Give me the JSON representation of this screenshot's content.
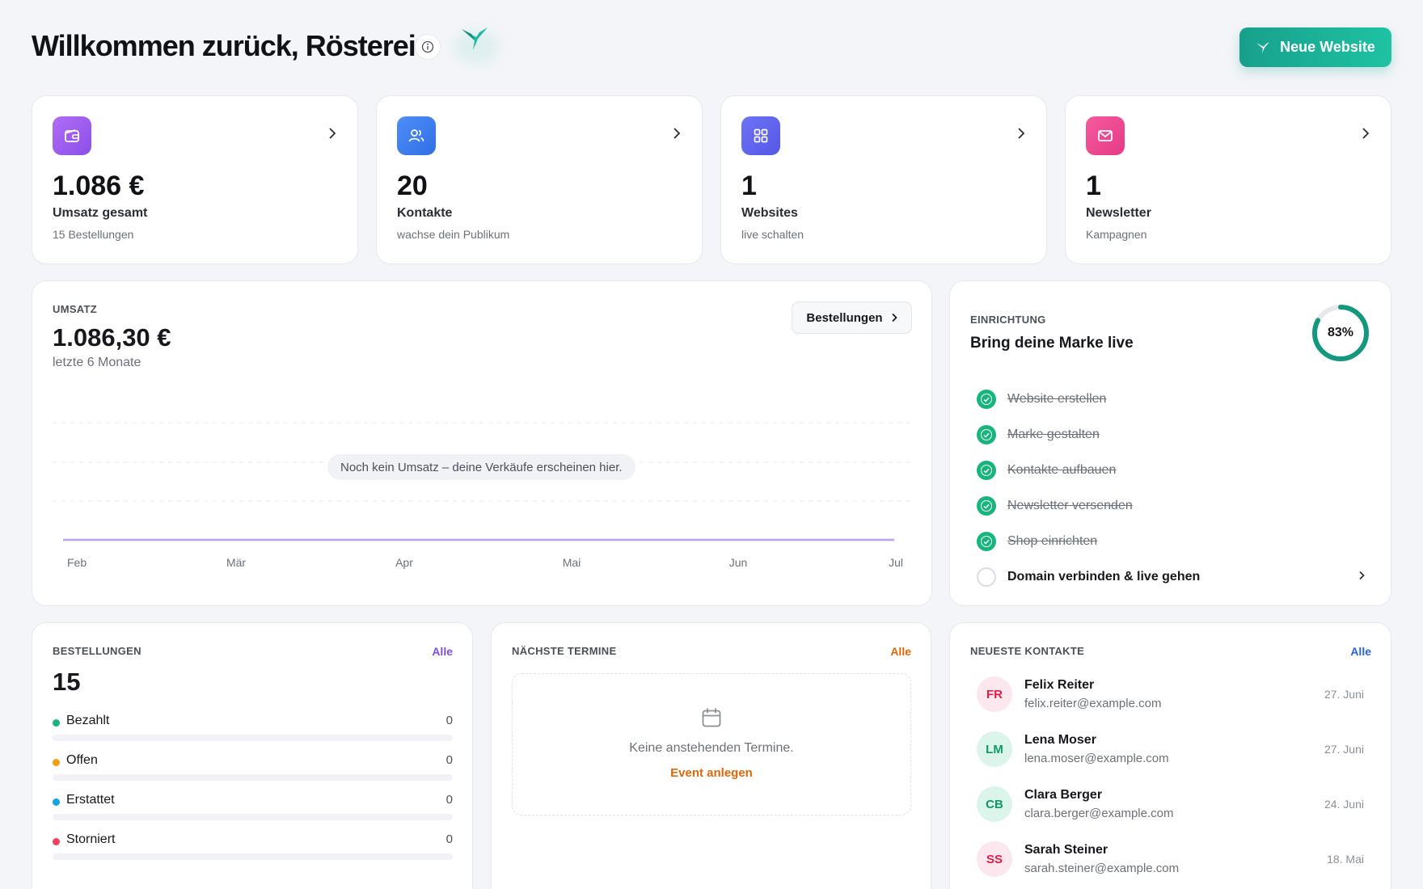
{
  "header": {
    "title": "Willkommen zurück, Rösterei",
    "new_website_label": "Neue Website"
  },
  "stats": [
    {
      "value": "1.086 €",
      "label": "Umsatz gesamt",
      "sub": "15 Bestellungen",
      "icon": "wallet-icon",
      "color": "#a05bf0"
    },
    {
      "value": "20",
      "label": "Kontakte",
      "sub": "wachse dein Publikum",
      "icon": "users-icon",
      "color": "#3b7ff2"
    },
    {
      "value": "1",
      "label": "Websites",
      "sub": "live schalten",
      "icon": "grid-icon",
      "color": "#6366f1"
    },
    {
      "value": "1",
      "label": "Newsletter",
      "sub": "Kampagnen",
      "icon": "mail-icon",
      "color": "#ec4899"
    }
  ],
  "revenue": {
    "section_label": "UMSATZ",
    "value": "1.086,30 €",
    "period": "letzte 6 Monate",
    "orders_button": "Bestellungen",
    "empty_message": "Noch kein Umsatz – deine Verkäufe erscheinen hier."
  },
  "chart_data": {
    "type": "line",
    "categories": [
      "Feb",
      "Mär",
      "Apr",
      "Mai",
      "Jun",
      "Jul"
    ],
    "values": [
      0,
      0,
      0,
      0,
      0,
      0
    ],
    "title": "",
    "xlabel": "",
    "ylabel": "",
    "grid": true,
    "line_color": "#b9a3f5"
  },
  "setup": {
    "section_label": "EINRICHTUNG",
    "title": "Bring deine Marke live",
    "progress_percent": 83,
    "progress_label": "83%",
    "tasks": [
      {
        "label": "Website erstellen",
        "done": true
      },
      {
        "label": "Marke gestalten",
        "done": true
      },
      {
        "label": "Kontakte aufbauen",
        "done": true
      },
      {
        "label": "Newsletter versenden",
        "done": true
      },
      {
        "label": "Shop einrichten",
        "done": true
      },
      {
        "label": "Domain verbinden & live gehen",
        "done": false
      }
    ]
  },
  "orders": {
    "section_label": "BESTELLUNGEN",
    "all_label": "Alle",
    "count": "15",
    "rows": [
      {
        "label": "Bezahlt",
        "value": "0",
        "color": "#17b57c"
      },
      {
        "label": "Offen",
        "value": "0",
        "color": "#f59e0b"
      },
      {
        "label": "Erstattet",
        "value": "0",
        "color": "#0ea5e9"
      },
      {
        "label": "Storniert",
        "value": "0",
        "color": "#f43f5e"
      }
    ]
  },
  "events": {
    "section_label": "NÄCHSTE TERMINE",
    "all_label": "Alle",
    "empty_text": "Keine anstehenden Termine.",
    "create_link": "Event anlegen"
  },
  "contacts": {
    "section_label": "NEUESTE KONTAKTE",
    "all_label": "Alle",
    "items": [
      {
        "initials": "FR",
        "name": "Felix Reiter",
        "email": "felix.reiter@example.com",
        "date": "27. Juni",
        "bg": "#fde7ee",
        "fg": "#e11d48"
      },
      {
        "initials": "LM",
        "name": "Lena Moser",
        "email": "lena.moser@example.com",
        "date": "27. Juni",
        "bg": "#dcf5ea",
        "fg": "#0f9a64"
      },
      {
        "initials": "CB",
        "name": "Clara Berger",
        "email": "clara.berger@example.com",
        "date": "24. Juni",
        "bg": "#dcf5ea",
        "fg": "#0f9a64"
      },
      {
        "initials": "SS",
        "name": "Sarah Steiner",
        "email": "sarah.steiner@example.com",
        "date": "18. Mai",
        "bg": "#fde7ee",
        "fg": "#e11d48"
      }
    ]
  },
  "colors": {
    "accent": "#17a08c",
    "orders_link": "#7c4dea",
    "events_link": "#e0680a",
    "contacts_link": "#2563eb"
  }
}
